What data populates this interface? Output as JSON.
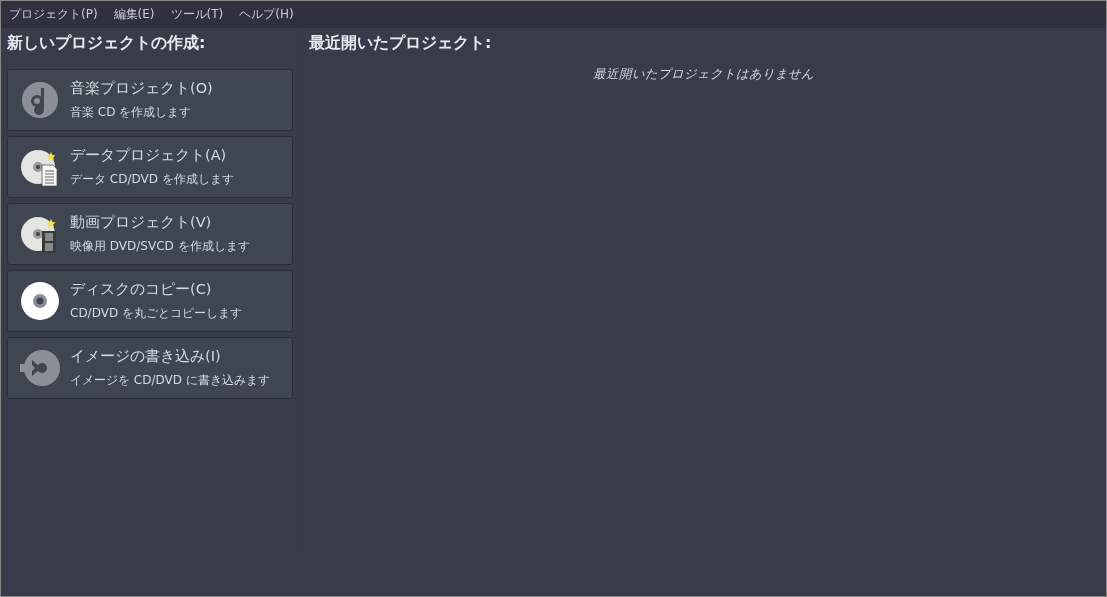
{
  "menu": [
    "プロジェクト(P)",
    "編集(E)",
    "ツール(T)",
    "ヘルプ(H)"
  ],
  "new_project": {
    "title": "新しいプロジェクトの作成:",
    "items": [
      {
        "kind": "audio",
        "label": "音楽プロジェクト(O)",
        "description": "音楽 CD を作成します"
      },
      {
        "kind": "data",
        "label": "データプロジェクト(A)",
        "description": "データ CD/DVD を作成します"
      },
      {
        "kind": "video",
        "label": "動画プロジェクト(V)",
        "description": "映像用 DVD/SVCD を作成します"
      },
      {
        "kind": "copy",
        "label": "ディスクのコピー(C)",
        "description": "CD/DVD を丸ごとコピーします"
      },
      {
        "kind": "burn",
        "label": "イメージの書き込み(I)",
        "description": "イメージを CD/DVD に書き込みます"
      }
    ]
  },
  "recent": {
    "title": "最近開いたプロジェクト:",
    "empty_message": "最近開いたプロジェクトはありません"
  }
}
